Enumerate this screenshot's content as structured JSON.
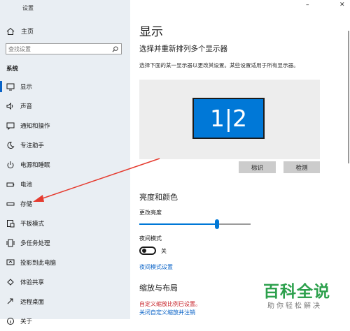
{
  "window": {
    "title": "设置",
    "minimize": "–",
    "close": "✕"
  },
  "sidebar": {
    "home": "主页",
    "search_placeholder": "查找设置",
    "section": "系统",
    "items": [
      {
        "label": "显示",
        "icon": "monitor-icon"
      },
      {
        "label": "声音",
        "icon": "speaker-icon"
      },
      {
        "label": "通知和操作",
        "icon": "notification-icon"
      },
      {
        "label": "专注助手",
        "icon": "moon-icon"
      },
      {
        "label": "电源和睡眠",
        "icon": "power-icon"
      },
      {
        "label": "电池",
        "icon": "battery-icon"
      },
      {
        "label": "存储",
        "icon": "storage-icon"
      },
      {
        "label": "平板模式",
        "icon": "tablet-icon"
      },
      {
        "label": "多任务处理",
        "icon": "multitask-icon"
      },
      {
        "label": "投影到此电脑",
        "icon": "project-icon"
      },
      {
        "label": "体验共享",
        "icon": "share-icon"
      },
      {
        "label": "远程桌面",
        "icon": "remote-icon"
      },
      {
        "label": "关于",
        "icon": "info-icon"
      }
    ]
  },
  "main": {
    "title": "显示",
    "rearrange_heading": "选择并重新排列多个显示器",
    "rearrange_desc": "选择下面的某一显示器以更改其设置。某些设置适用于所有显示器。",
    "monitor_label": "1|2",
    "identify_button": "标识",
    "detect_button": "检测",
    "brightness_heading": "亮度和颜色",
    "brightness_label": "更改亮度",
    "brightness_value": 0.7,
    "night_mode_label": "夜间模式",
    "night_mode_state": "关",
    "night_mode_settings_link": "夜间模式设置",
    "scale_heading": "缩放与布局",
    "custom_scale_notice": "自定义缩放比例已设置。",
    "custom_scale_link": "关闭自定义缩放并注销"
  },
  "watermark": {
    "big": "百科全说",
    "small": "助你轻松解决"
  },
  "colors": {
    "accent": "#0078d7",
    "annotation_arrow": "#e53b2f",
    "watermark": "#2ca04c"
  }
}
